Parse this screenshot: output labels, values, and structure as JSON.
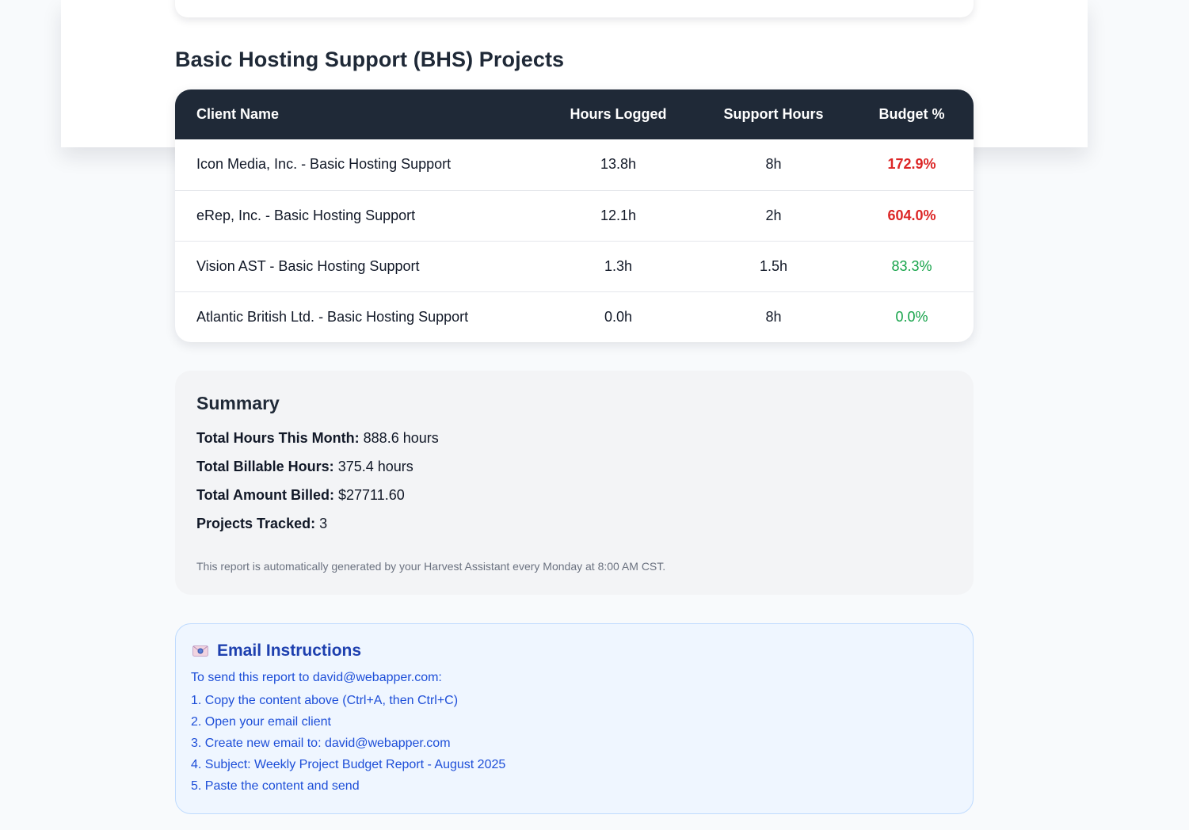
{
  "bhs": {
    "title": "Basic Hosting Support (BHS) Projects",
    "columns": {
      "client": "Client Name",
      "hours_logged": "Hours Logged",
      "support_hours": "Support Hours",
      "budget": "Budget %"
    },
    "rows": [
      {
        "client": "Icon Media, Inc. - Basic Hosting Support",
        "hours_logged": "13.8h",
        "support_hours": "8h",
        "budget": "172.9%"
      },
      {
        "client": "eRep, Inc. - Basic Hosting Support",
        "hours_logged": "12.1h",
        "support_hours": "2h",
        "budget": "604.0%"
      },
      {
        "client": "Vision AST - Basic Hosting Support",
        "hours_logged": "1.3h",
        "support_hours": "1.5h",
        "budget": "83.3%"
      },
      {
        "client": "Atlantic British Ltd. - Basic Hosting Support",
        "hours_logged": "0.0h",
        "support_hours": "8h",
        "budget": "0.0%"
      }
    ]
  },
  "summary": {
    "title": "Summary",
    "total_hours_label": "Total Hours This Month:",
    "total_hours_value": "888.6 hours",
    "billable_hours_label": "Total Billable Hours:",
    "billable_hours_value": "375.4 hours",
    "amount_billed_label": "Total Amount Billed:",
    "amount_billed_value": "$27711.60",
    "projects_tracked_label": "Projects Tracked:",
    "projects_tracked_value": "3",
    "note": "This report is automatically generated by your Harvest Assistant every Monday at 8:00 AM CST."
  },
  "email": {
    "icon": "envelope-icon",
    "title": "Email Instructions",
    "intro": "To send this report to david@webapper.com:",
    "steps": [
      "1. Copy the content above (Ctrl+A, then Ctrl+C)",
      "2. Open your email client",
      "3. Create new email to: david@webapper.com",
      "4. Subject: Weekly Project Budget Report - August 2025",
      "5. Paste the content and send"
    ]
  },
  "colors": {
    "header_bg": "#1f2937",
    "over_budget": "#dc2626",
    "under_budget": "#16a34a",
    "email_accent": "#1e40af"
  }
}
